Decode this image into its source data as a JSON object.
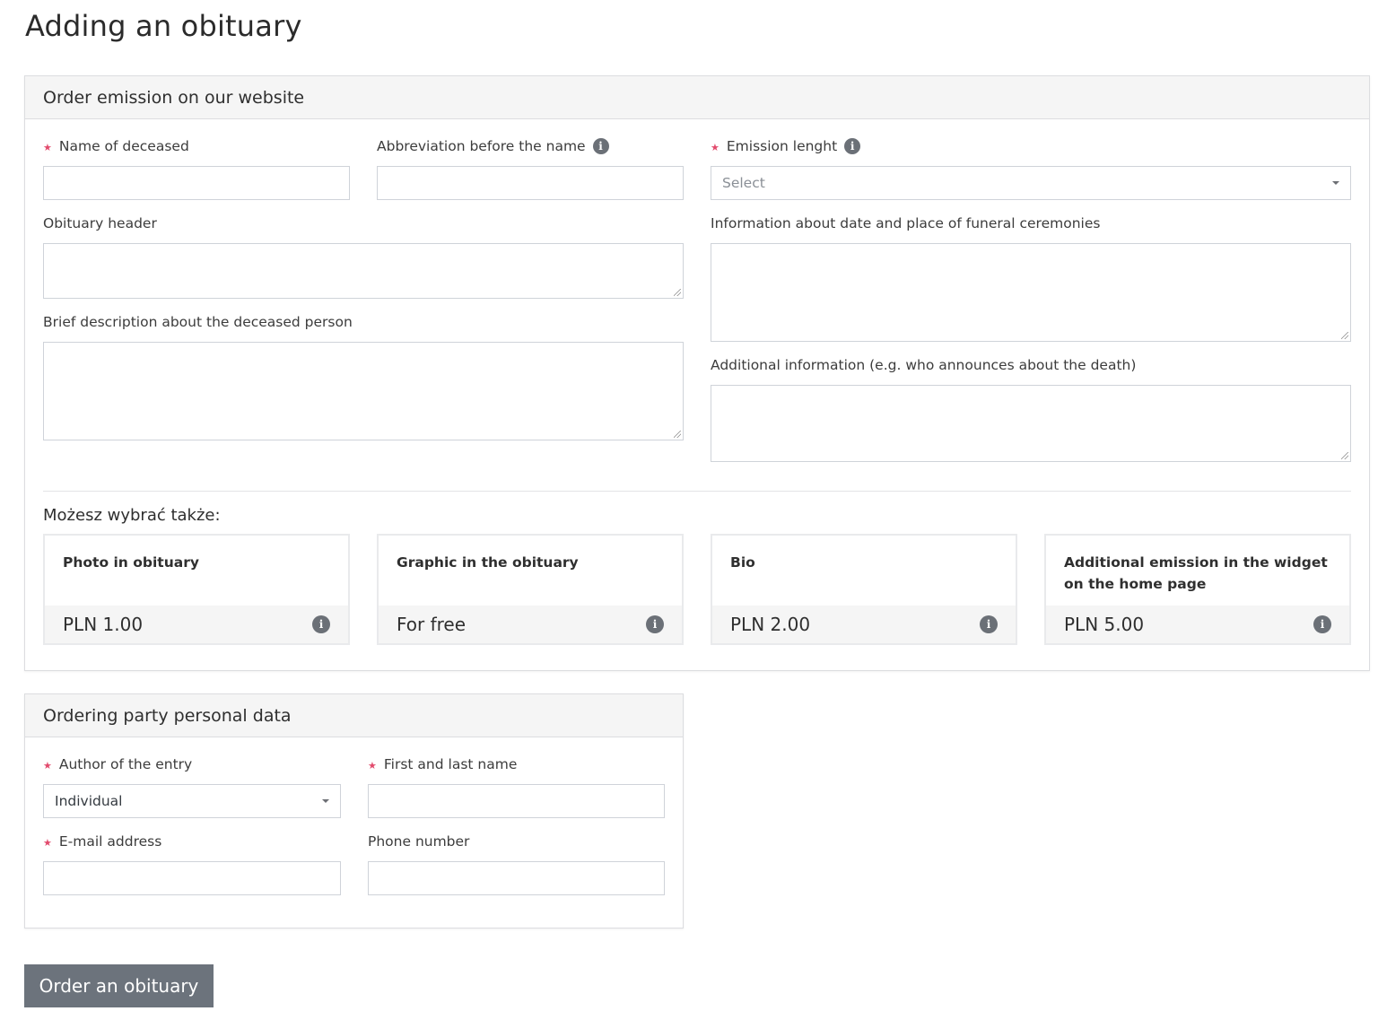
{
  "page": {
    "title": "Adding an obituary"
  },
  "emission_panel": {
    "header": "Order emission on our website",
    "fields": {
      "name_of_deceased": {
        "label": "Name of deceased",
        "required": true,
        "value": ""
      },
      "abbreviation": {
        "label": "Abbreviation before the name",
        "required": false,
        "value": "",
        "icon": "info-icon"
      },
      "emission_length": {
        "label": "Emission lenght",
        "required": true,
        "value": "",
        "placeholder": "Select",
        "icon": "info-icon"
      },
      "obituary_header": {
        "label": "Obituary header",
        "value": ""
      },
      "funeral_info": {
        "label": "Information about date and place of funeral ceremonies",
        "value": ""
      },
      "brief_description": {
        "label": "Brief description about the deceased person",
        "value": ""
      },
      "additional_info": {
        "label": "Additional information (e.g. who announces about the death)",
        "value": ""
      }
    },
    "extras_label": "Możesz wybrać także:",
    "extras": [
      {
        "title": "Photo in obituary",
        "price": "PLN 1.00",
        "icon": "info-icon"
      },
      {
        "title": "Graphic in the obituary",
        "price": "For free",
        "icon": "info-icon"
      },
      {
        "title": "Bio",
        "price": "PLN 2.00",
        "icon": "info-icon"
      },
      {
        "title": "Additional emission in the widget on the home page",
        "price": "PLN 5.00",
        "icon": "info-icon"
      }
    ]
  },
  "personal_panel": {
    "header": "Ordering party personal data",
    "fields": {
      "author": {
        "label": "Author of the entry",
        "required": true,
        "value": "Individual"
      },
      "full_name": {
        "label": "First and last name",
        "required": true,
        "value": ""
      },
      "email": {
        "label": "E-mail address",
        "required": true,
        "value": ""
      },
      "phone": {
        "label": "Phone number",
        "required": false,
        "value": ""
      }
    }
  },
  "symbols": {
    "required": "★",
    "info": "i"
  },
  "submit": {
    "label": "Order an obituary"
  },
  "colors": {
    "required": "#e24a6c",
    "button": "#6c737c",
    "info_icon": "#6b7077"
  }
}
